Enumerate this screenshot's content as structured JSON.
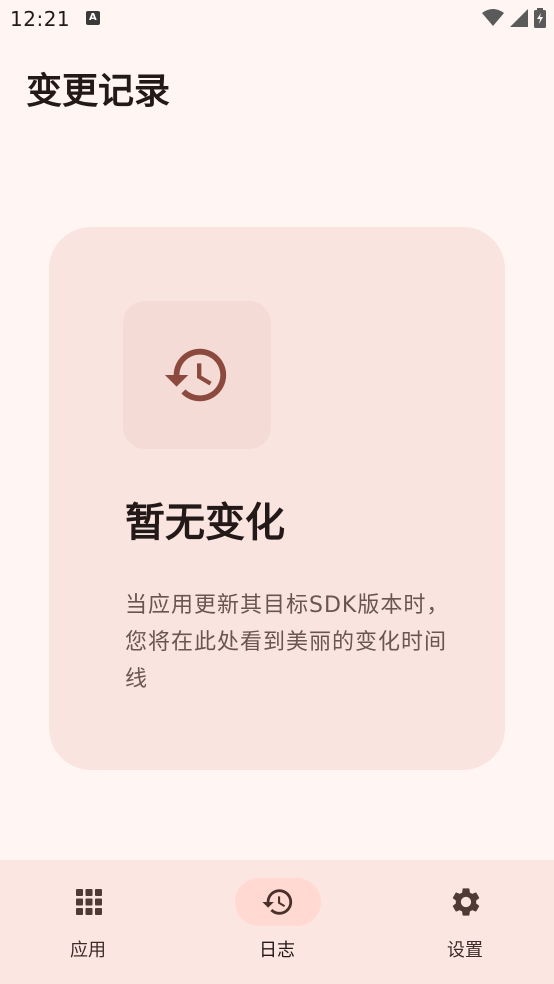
{
  "status_bar": {
    "time": "12:21",
    "notification_icon": "A",
    "icons": [
      "wifi-icon",
      "cell-signal-icon",
      "battery-charging-icon"
    ]
  },
  "page": {
    "title": "变更记录"
  },
  "empty_state": {
    "icon": "history-icon",
    "title": "暂无变化",
    "description": "当应用更新其目标SDK版本时，您将在此处看到美丽的变化时间线"
  },
  "bottom_nav": {
    "items": [
      {
        "label": "应用",
        "icon": "apps-grid-icon",
        "active": false
      },
      {
        "label": "日志",
        "icon": "history-icon",
        "active": true
      },
      {
        "label": "设置",
        "icon": "gear-icon",
        "active": false
      }
    ]
  },
  "colors": {
    "background": "#fff6f4",
    "card": "#f9e4df",
    "icon_tile": "#f5dbd6",
    "accent": "#8c4a3e",
    "nav_bar": "#fce6e2",
    "active_pill": "#ffd9d2"
  }
}
